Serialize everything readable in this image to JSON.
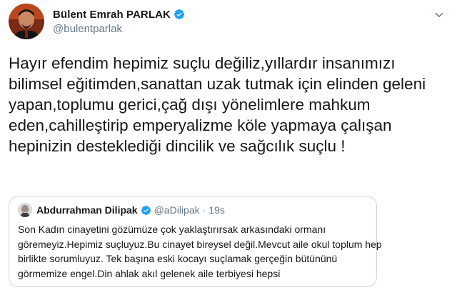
{
  "tweet": {
    "author": {
      "display_name": "Bülent Emrah PARLAK",
      "handle": "@bulentparlak",
      "verified": true
    },
    "text": "Hayır efendim hepimiz suçlu değiliz,yıllardır insanımızı bilimsel eğitimden,sanattan uzak tutmak için elinden geleni yapan,toplumu gerici,çağ dışı yönelimlere mahkum eden,cahilleştirip emperyalizme köle yapmaya çalışan hepinizin desteklediği dincilik ve sağcılık suçlu !",
    "quoted": {
      "display_name": "Abdurrahman Dilipak",
      "handle": "@aDilipak",
      "separator": "·",
      "time": "19s",
      "verified": true,
      "text_lines": [
        "Son Kadın cinayetini gözümüze çok yaklaştırırsak arkasındaki ormanı",
        "göremeyiz.Hepimiz suçluyuz.Bu cinayet bireysel değil.Mevcut aile okul toplum hep",
        "birlikte sorumluyuz. Tek başına eski kocayı suçlamak gerçeğin bütününü",
        "görmemize engel.Din ahlak akıl gelenek aile terbiyesi hepsi"
      ]
    }
  },
  "colors": {
    "text": "#14171a",
    "secondary": "#657786",
    "verified": "#1da1f2",
    "border": "#ccd6dd"
  },
  "icons": {
    "verified": "verified-badge-icon",
    "more": "chevron-down-icon"
  }
}
